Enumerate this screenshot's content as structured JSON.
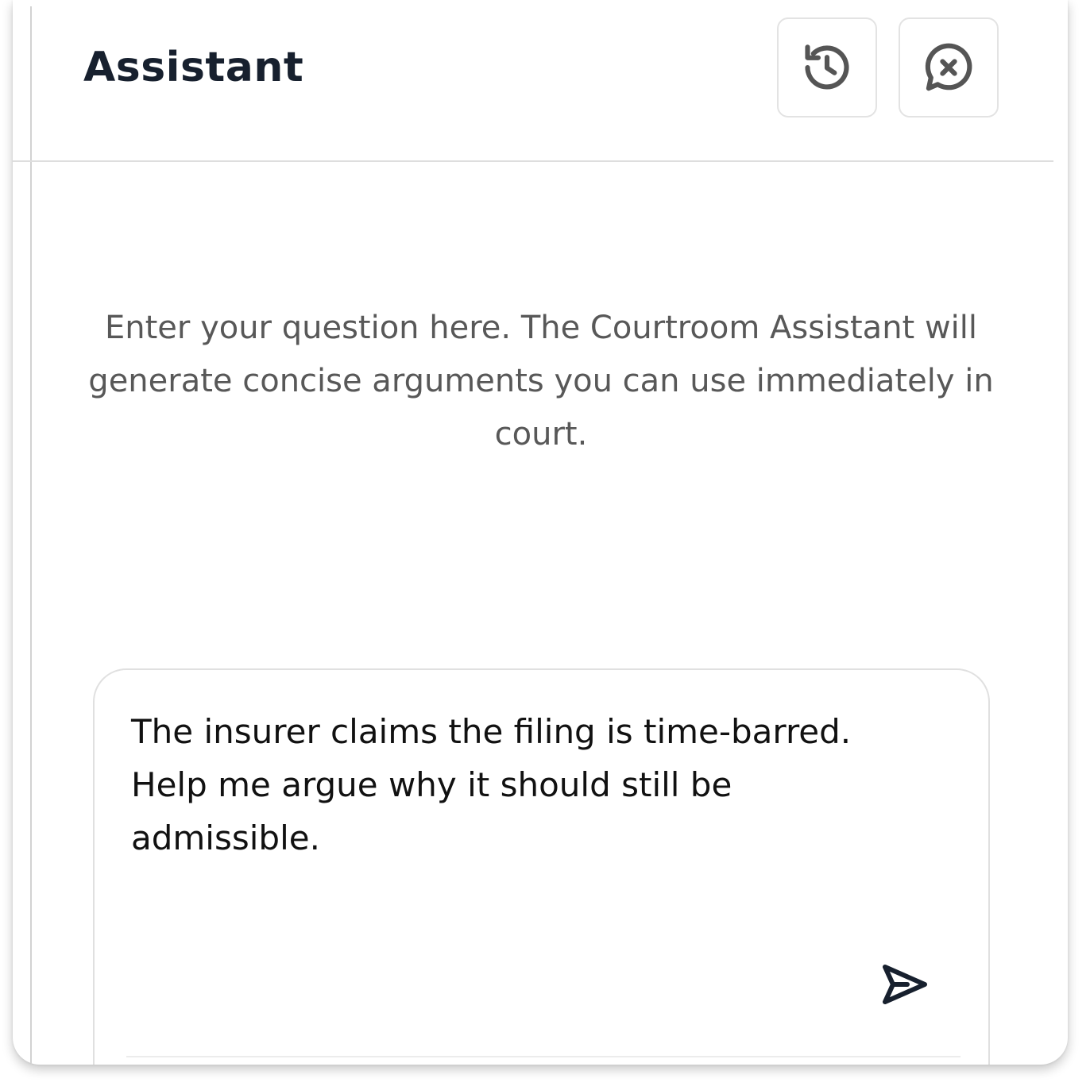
{
  "header": {
    "title": "Assistant",
    "buttons": [
      {
        "name": "history-button",
        "icon": "history-icon"
      },
      {
        "name": "close-chat-button",
        "icon": "chat-close-icon"
      }
    ]
  },
  "main": {
    "intro_text": "Enter your question here. The Courtroom Assistant will generate concise arguments you can use immediately in court."
  },
  "composer": {
    "value": "The insurer claims the filing is time-barred. Help me argue why it should still be admissible.",
    "send_icon": "send-icon"
  },
  "colors": {
    "title": "#17202e",
    "icon_stroke": "#555555",
    "body_text": "#585858",
    "send_icon": "#17202e"
  }
}
